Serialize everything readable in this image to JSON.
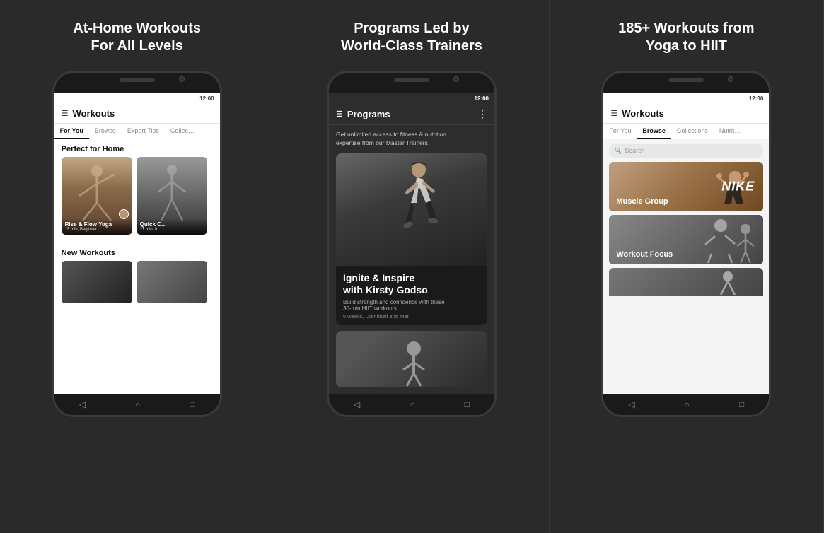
{
  "panels": [
    {
      "id": "panel1",
      "title": "At-Home Workouts\nFor All Levels",
      "phone": {
        "header_title": "Workouts",
        "tabs": [
          "For You",
          "Browse",
          "Expert Tips",
          "Collec…"
        ],
        "active_tab": "For You",
        "section1": "Perfect for Home",
        "cards": [
          {
            "title": "Rise & Flow Yoga",
            "sub": "15 min, Beginner",
            "color": "yoga"
          },
          {
            "title": "Quick C…",
            "sub": "21 min, In…",
            "color": "gym"
          }
        ],
        "section2": "New Workouts"
      }
    },
    {
      "id": "panel2",
      "title": "Programs Led by\nWorld-Class Trainers",
      "phone": {
        "header_title": "Programs",
        "intro": "Get unlimited access to fitness & nutrition\nexpertise from our Master Trainers.",
        "featured": {
          "title": "Ignite & Inspire\nwith Kirsty Godso",
          "desc": "Build strength and confidence with these\n30-min HIIT workouts",
          "meta": "6 weeks, Dumbbell and Mat"
        }
      }
    },
    {
      "id": "panel3",
      "title": "185+ Workouts from\nYoga to HIIT",
      "phone": {
        "header_title": "Workouts",
        "tabs": [
          "For You",
          "Browse",
          "Collections",
          "Nutriti…"
        ],
        "active_tab": "Browse",
        "search_placeholder": "Search",
        "categories": [
          {
            "label": "Muscle Group"
          },
          {
            "label": "Workout Focus"
          }
        ]
      }
    }
  ],
  "icons": {
    "menu": "☰",
    "more": "⋮",
    "search": "🔍",
    "back": "◁",
    "home": "○",
    "recent": "□"
  }
}
